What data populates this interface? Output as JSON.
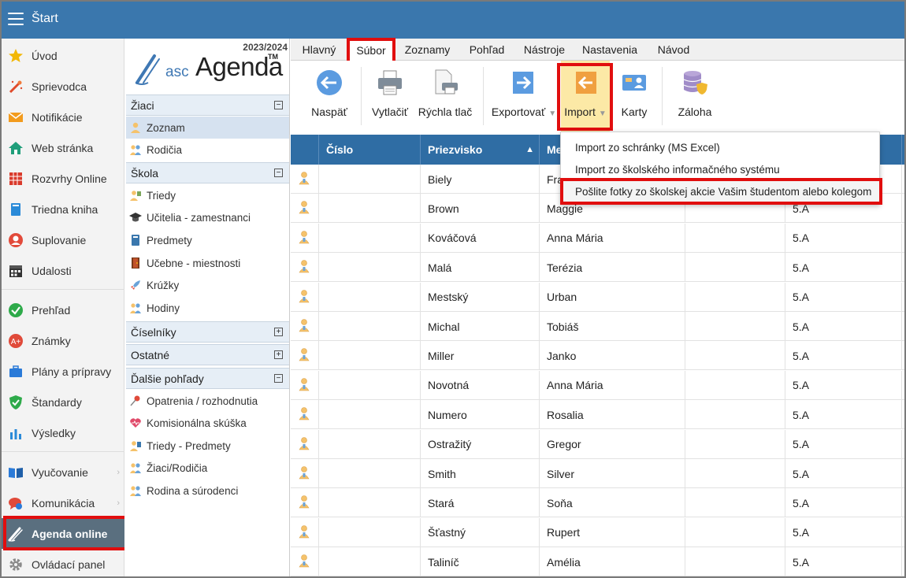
{
  "app": {
    "title": "Štart"
  },
  "sidebar": {
    "items": [
      {
        "label": "Úvod",
        "icon": "star-icon"
      },
      {
        "label": "Sprievodca",
        "icon": "wand-icon"
      },
      {
        "label": "Notifikácie",
        "icon": "envelope-icon"
      },
      {
        "label": "Web stránka",
        "icon": "house-icon"
      },
      {
        "label": "Rozvrhy Online",
        "icon": "timetable-icon"
      },
      {
        "label": "Triedna kniha",
        "icon": "book-icon"
      },
      {
        "label": "Suplovanie",
        "icon": "substitution-icon"
      },
      {
        "label": "Udalosti",
        "icon": "calendar-icon"
      },
      {
        "label": "Prehľad",
        "icon": "check-circle-icon"
      },
      {
        "label": "Známky",
        "icon": "grades-icon"
      },
      {
        "label": "Plány a prípravy",
        "icon": "briefcase-icon"
      },
      {
        "label": "Štandardy",
        "icon": "shield-check-icon"
      },
      {
        "label": "Výsledky",
        "icon": "bar-chart-icon"
      },
      {
        "label": "Vyučovanie",
        "icon": "open-book-icon"
      },
      {
        "label": "Komunikácia",
        "icon": "chat-icon"
      },
      {
        "label": "Agenda online",
        "icon": "agenda-icon"
      },
      {
        "label": "Ovládací panel",
        "icon": "gear-icon"
      }
    ]
  },
  "agenda": {
    "year": "2023/2024",
    "logo_asc": "asc",
    "logo_agenda": "Agenda",
    "logo_tm": "TM",
    "sections": {
      "ziaci": "Žiaci",
      "skola": "Škola",
      "ciselniky": "Číselníky",
      "ostatne": "Ostatné",
      "dalsie": "Ďalšie pohľady"
    },
    "ziaci_items": [
      "Zoznam",
      "Rodičia"
    ],
    "skola_items": [
      "Triedy",
      "Učitelia - zamestnanci",
      "Predmety",
      "Učebne - miestnosti",
      "Krúžky",
      "Hodiny"
    ],
    "dalsie_items": [
      "Opatrenia / rozhodnutia",
      "Komisionálna skúška",
      "Triedy - Predmety",
      "Žiaci/Rodičia",
      "Rodina a súrodenci"
    ]
  },
  "menu": {
    "tabs": [
      "Hlavný",
      "Súbor",
      "Zoznamy",
      "Pohľad",
      "Nástroje",
      "Nastavenia",
      "Návod"
    ],
    "active_tab": "Súbor"
  },
  "toolbar": {
    "back": "Naspäť",
    "print": "Vytlačiť",
    "quick_print": "Rýchla tlač",
    "export": "Exportovať",
    "import": "Import",
    "cards": "Karty",
    "backup": "Záloha"
  },
  "dropdown": {
    "items": [
      "Import zo schránky (MS Excel)",
      "Import zo školského informačného systému",
      "Pošlite fotky zo školskej akcie Vašim študentom alebo kolegom"
    ]
  },
  "grid": {
    "headers": [
      "Číslo",
      "Priezvisko",
      "Me"
    ],
    "sort_indicator": "▲",
    "rows": [
      {
        "cislo": "",
        "priezvisko": "Biely",
        "meno": "Fra",
        "trieda": ""
      },
      {
        "cislo": "",
        "priezvisko": "Brown",
        "meno": "Maggie",
        "trieda": "5.A"
      },
      {
        "cislo": "",
        "priezvisko": "Kováčová",
        "meno": "Anna Mária",
        "trieda": "5.A"
      },
      {
        "cislo": "",
        "priezvisko": "Malá",
        "meno": "Terézia",
        "trieda": "5.A"
      },
      {
        "cislo": "",
        "priezvisko": "Mestský",
        "meno": "Urban",
        "trieda": "5.A"
      },
      {
        "cislo": "",
        "priezvisko": "Michal",
        "meno": "Tobiáš",
        "trieda": "5.A"
      },
      {
        "cislo": "",
        "priezvisko": "Miller",
        "meno": "Janko",
        "trieda": "5.A"
      },
      {
        "cislo": "",
        "priezvisko": "Novotná",
        "meno": "Anna Mária",
        "trieda": "5.A"
      },
      {
        "cislo": "",
        "priezvisko": "Numero",
        "meno": "Rosalia",
        "trieda": "5.A"
      },
      {
        "cislo": "",
        "priezvisko": "Ostražitý",
        "meno": "Gregor",
        "trieda": "5.A"
      },
      {
        "cislo": "",
        "priezvisko": "Smith",
        "meno": "Silver",
        "trieda": "5.A"
      },
      {
        "cislo": "",
        "priezvisko": "Stará",
        "meno": "Soňa",
        "trieda": "5.A"
      },
      {
        "cislo": "",
        "priezvisko": "Šťastný",
        "meno": "Rupert",
        "trieda": "5.A"
      },
      {
        "cislo": "",
        "priezvisko": "Taliníč",
        "meno": "Amélia",
        "trieda": "5.A"
      }
    ]
  },
  "colors": {
    "brand": "#3a77ad",
    "header": "#2f6da4",
    "highlight": "#e10e0e",
    "active_nav": "#5a6f7f"
  }
}
